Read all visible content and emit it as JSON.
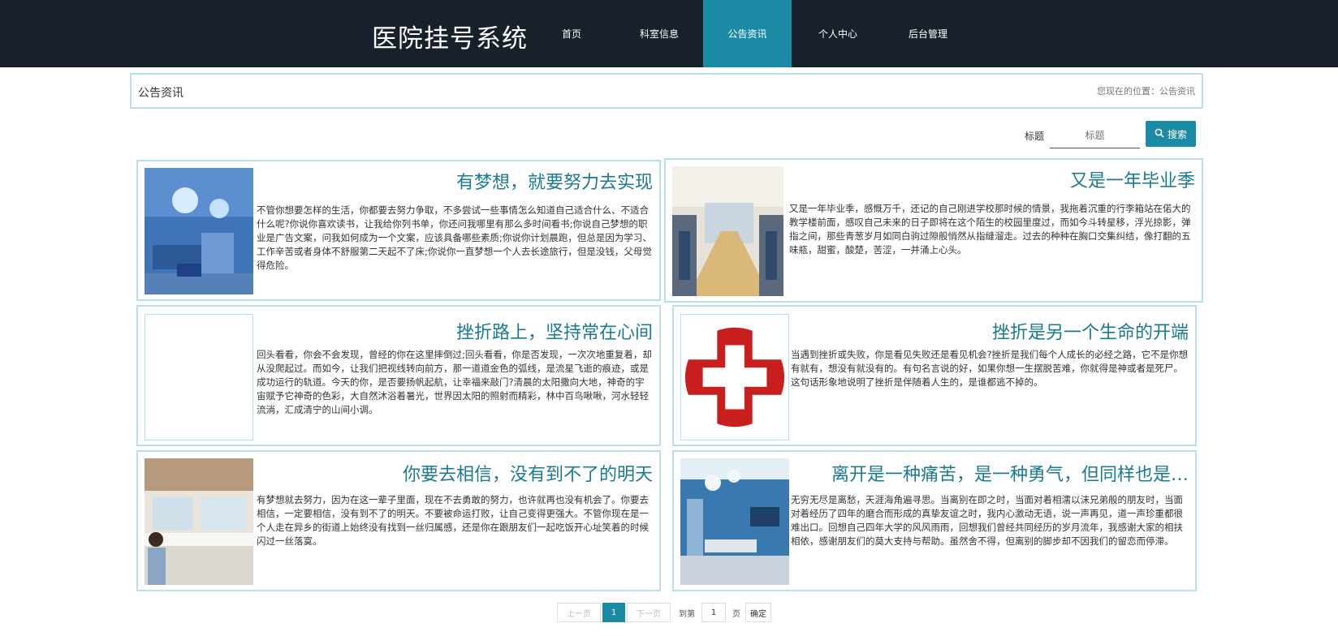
{
  "header": {
    "brand": "医院挂号系统",
    "nav": [
      {
        "label": "首页",
        "active": false
      },
      {
        "label": "科室信息",
        "active": false
      },
      {
        "label": "公告资讯",
        "active": true
      },
      {
        "label": "个人中心",
        "active": false
      },
      {
        "label": "后台管理",
        "active": false
      }
    ]
  },
  "breadcrumb": {
    "title": "公告资讯",
    "location": "您现在的位置：公告资讯"
  },
  "search": {
    "label": "标题",
    "placeholder": "标题",
    "button": "搜索"
  },
  "articles": [
    {
      "title": "有梦想，就要努力去实现",
      "body": "不管你想要怎样的生活，你都要去努力争取，不多尝试一些事情怎么知道自己适合什么、不适合什么呢?你说你喜欢读书，让我给你列书单，你还问我哪里有那么多时间看书;你说自己梦想的职业是广告文案，问我如何成为一个文案，应该具备哪些素质;你说你计划晨跑，但总是因为学习、工作辛苦或者身体不舒服第二天起不了床;你说你一直梦想一个人去长途旅行，但是没钱，父母觉得危险。",
      "image": "operating-room-image"
    },
    {
      "title": "又是一年毕业季",
      "body": "又是一年毕业季，感慨万千，还记的自己刚进学校那时候的情景，我拖着沉重的行李箱站在偌大的教学楼前面，感叹自己未来的日子即将在这个陌生的校园里度过，而如今斗转星移，浮光掠影，弹指之间，那些青葱岁月如同白驹过隙般悄然从指缝溜走。过去的种种在胸口交集纠结，像打翻的五味瓶，甜蜜，酸楚，苦涩，一并涌上心头。",
      "image": "hospital-ward-image"
    },
    {
      "title": "挫折路上，坚持常在心间",
      "body": "回头看看，你会不会发现，曾经的你在这里摔倒过;回头看看，你是否发现，一次次地重复着，却从没爬起过。而如今，让我们把视线转向前方，那一道道金色的弧线，是流星飞逝的痕迹，或是成功运行的轨道。今天的你，是否要扬帆起航，让幸福来敲门?清晨的太阳撒向大地，神奇的宇宙赋予它神奇的色彩，大自然沐浴着暑光，世界因太阳的照射而精彩，林中百鸟啾啾，河水轻轻流淌，汇成清宁的山间小调。",
      "image": "blank-image"
    },
    {
      "title": "挫折是另一个生命的开端",
      "body": "当遇到挫折或失败，你是看见失败还是看见机会?挫折是我们每个人成长的必经之路，它不是你想有就有，想没有就没有的。有句名言说的好，如果你想一生摆脱苦难，你就得是神或者是死尸。这句话形象地说明了挫折是伴随着人生的，是谁都逃不掉的。",
      "image": "red-cross-image"
    },
    {
      "title": "你要去相信，没有到不了的明天",
      "body": "有梦想就去努力，因为在这一辈子里面，现在不去勇敢的努力，也许就再也没有机会了。你要去相信，一定要相信，没有到不了的明天。不要被命运打败，让自己变得更强大。不管你现在是一个人走在异乡的街道上始终没有找到一丝归属感，还是你在跟朋友们一起吃饭开心址笑着的时候闪过一丝落寞。",
      "image": "reception-desk-image"
    },
    {
      "title": "离开是一种痛苦，是一种勇气，但同样也是…",
      "body": "无穷无尽是离愁，天涯海角遍寻思。当离别在即之时，当面对着相濡以沫兄弟般的朋友时，当面对着经历了四年的磨合而形成的真挚友谊之时，我内心激动无语，说一声再见，道一声珍重都很难出口。回想自己四年大学的风风雨雨，回想我们曾经共同经历的岁月流年，我感谢大家的相扶相依，感谢朋友们的莫大支持与帮助。虽然舍不得，但离别的脚步却不因我们的留恋而停滞。",
      "image": "surgery-room-image"
    }
  ],
  "pager": {
    "prev": "上一页",
    "current": "1",
    "next": "下一页",
    "goto_label": "到第",
    "goto_value": "1",
    "page_unit": "页",
    "confirm": "确定"
  },
  "colors": {
    "nav_bg": "#17202b",
    "accent": "#1b8ba5",
    "title": "#1b7a8f",
    "card_border": "#b9e0e8"
  }
}
